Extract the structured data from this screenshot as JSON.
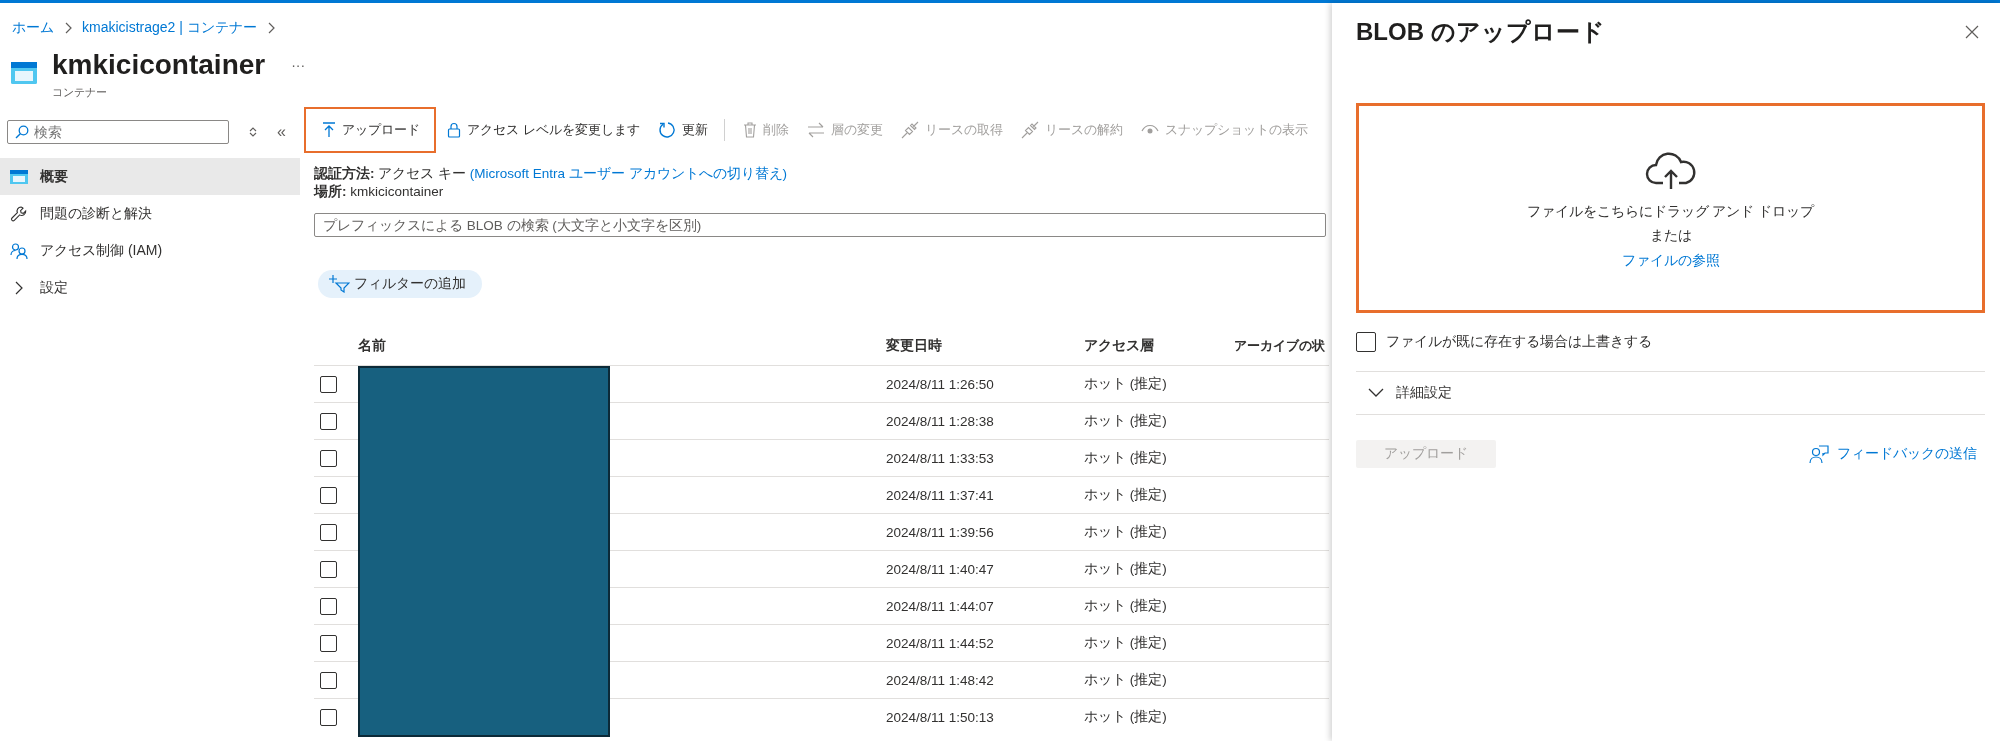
{
  "breadcrumb": [
    "ホーム",
    "kmakicistrage2 | コンテナー"
  ],
  "title": "kmkicicontainer",
  "subtitle": "コンテナー",
  "more": "···",
  "nav": {
    "search": {
      "placeholder": "検索"
    },
    "collapse": "«",
    "items": [
      {
        "label": "概要",
        "selected": true
      },
      {
        "label": "問題の診断と解決",
        "selected": false
      },
      {
        "label": "アクセス制御 (IAM)",
        "selected": false
      },
      {
        "label": "設定",
        "selected": false
      }
    ]
  },
  "toolbar": [
    {
      "label": "アップロード",
      "disabled": false,
      "highlighted": true
    },
    {
      "label": "アクセス レベルを変更します",
      "disabled": false,
      "highlighted": false
    },
    {
      "label": "更新",
      "disabled": false,
      "highlighted": false
    },
    {
      "label": "削除",
      "disabled": true,
      "highlighted": false
    },
    {
      "label": "層の変更",
      "disabled": true,
      "highlighted": false
    },
    {
      "label": "リースの取得",
      "disabled": true,
      "highlighted": false
    },
    {
      "label": "リースの解約",
      "disabled": true,
      "highlighted": false
    },
    {
      "label": "スナップショットの表示",
      "disabled": true,
      "highlighted": false
    }
  ],
  "auth": {
    "label": "認証方法:",
    "value": "アクセス キー",
    "link": "(Microsoft Entra ユーザー アカウントへの切り替え)"
  },
  "location": {
    "label": "場所:",
    "value": "kmkicicontainer"
  },
  "blob_search": {
    "placeholder": "プレフィックスによる BLOB の検索 (大文字と小文字を区別)"
  },
  "filter_button": "フィルターの追加",
  "table": {
    "columns": [
      "名前",
      "変更日時",
      "アクセス層",
      "アーカイブの状"
    ],
    "rows": [
      {
        "checked": false,
        "modified": "2024/8/11 1:26:50",
        "tier": "ホット (推定)"
      },
      {
        "checked": false,
        "modified": "2024/8/11 1:28:38",
        "tier": "ホット (推定)"
      },
      {
        "checked": false,
        "modified": "2024/8/11 1:33:53",
        "tier": "ホット (推定)"
      },
      {
        "checked": false,
        "modified": "2024/8/11 1:37:41",
        "tier": "ホット (推定)"
      },
      {
        "checked": false,
        "modified": "2024/8/11 1:39:56",
        "tier": "ホット (推定)"
      },
      {
        "checked": false,
        "modified": "2024/8/11 1:40:47",
        "tier": "ホット (推定)"
      },
      {
        "checked": false,
        "modified": "2024/8/11 1:44:07",
        "tier": "ホット (推定)"
      },
      {
        "checked": false,
        "modified": "2024/8/11 1:44:52",
        "tier": "ホット (推定)"
      },
      {
        "checked": false,
        "modified": "2024/8/11 1:48:42",
        "tier": "ホット (推定)"
      },
      {
        "checked": false,
        "modified": "2024/8/11 1:50:13",
        "tier": "ホット (推定)"
      }
    ]
  },
  "panel": {
    "title": "BLOB のアップロード",
    "dropzone": {
      "text": "ファイルをこちらにドラッグ アンド ドロップ",
      "or": "または",
      "link": "ファイルの参照"
    },
    "overwrite": {
      "label": "ファイルが既に存在する場合は上書きする",
      "checked": false
    },
    "advanced": {
      "label": "詳細設定",
      "expanded": false
    },
    "upload_button": {
      "label": "アップロード",
      "disabled": true
    },
    "feedback": "フィードバックの送信"
  }
}
